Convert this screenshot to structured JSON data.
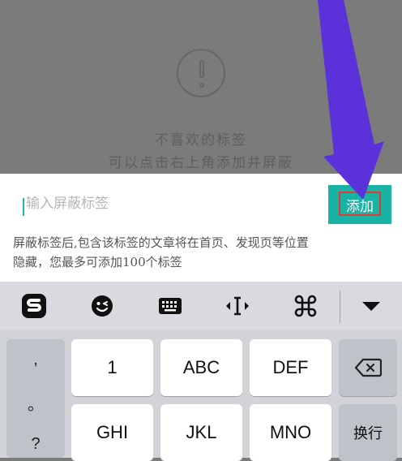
{
  "background": {
    "empty_line1": "不喜欢的标签",
    "empty_line2": "可以点击右上角添加并屏蔽"
  },
  "dialog": {
    "input_placeholder": "输入屏蔽标签",
    "add_label": "添加",
    "hint_line1": "屏蔽标签后,包含该标签的文章将在首页、发现页等位置",
    "hint_line2": "隐藏，您最多可添加100个标签"
  },
  "keyboard": {
    "punctuation": [
      ",",
      "。",
      "?"
    ],
    "keys": {
      "k1": "1",
      "k2": "ABC",
      "k3": "DEF",
      "k4": "GHI",
      "k5": "JKL",
      "k6": "MNO"
    },
    "enter_label": "换行"
  },
  "colors": {
    "accent": "#19b3a6",
    "highlight": "#e03a33",
    "arrow": "#5b31d9"
  },
  "icons": [
    "sogou-logo-icon",
    "emoji-icon",
    "keyboard-icon",
    "text-cursor-icon",
    "command-icon",
    "collapse-icon",
    "backspace-icon"
  ]
}
